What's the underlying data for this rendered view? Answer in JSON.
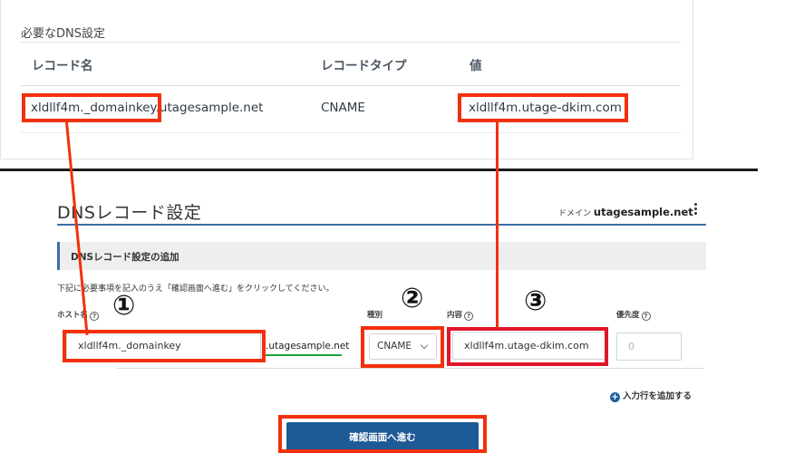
{
  "required_dns": {
    "title": "必要なDNS設定",
    "headers": [
      "レコード名",
      "レコードタイプ",
      "値"
    ],
    "row": {
      "record_name_highlight": "xldllf4m._domainkey",
      "record_name_suffix": ".utagesample.net",
      "record_type": "CNAME",
      "value": "xldllf4m.utage-dkim.com"
    }
  },
  "dns_settings": {
    "page_title": "DNSレコード設定",
    "domain_prefix": "ドメイン",
    "domain": "utagesample.net",
    "section_title": "DNSレコード設定の追加",
    "instruction": "下記に必要事項を記入のうえ「確認画面へ進む」をクリックしてください。",
    "labels": {
      "host": "ホスト名",
      "type": "種別",
      "content": "内容",
      "priority": "優先度"
    },
    "host_value": "xldllf4m._domainkey",
    "host_suffix": ".utagesample.net",
    "type_selected": "CNAME",
    "content_value": "xldllf4m.utage-dkim.com",
    "priority_placeholder": "0",
    "add_row_label": "入力行を追加する",
    "confirm_label": "確認画面へ進む"
  },
  "annotations": {
    "badge_1": "①",
    "badge_2": "②",
    "badge_3": "③",
    "highlight_color": "#f2300c"
  },
  "colors": {
    "accent": "#1e5a96",
    "rule": "#3a6fa8",
    "underline_green": "#1aa33a"
  }
}
